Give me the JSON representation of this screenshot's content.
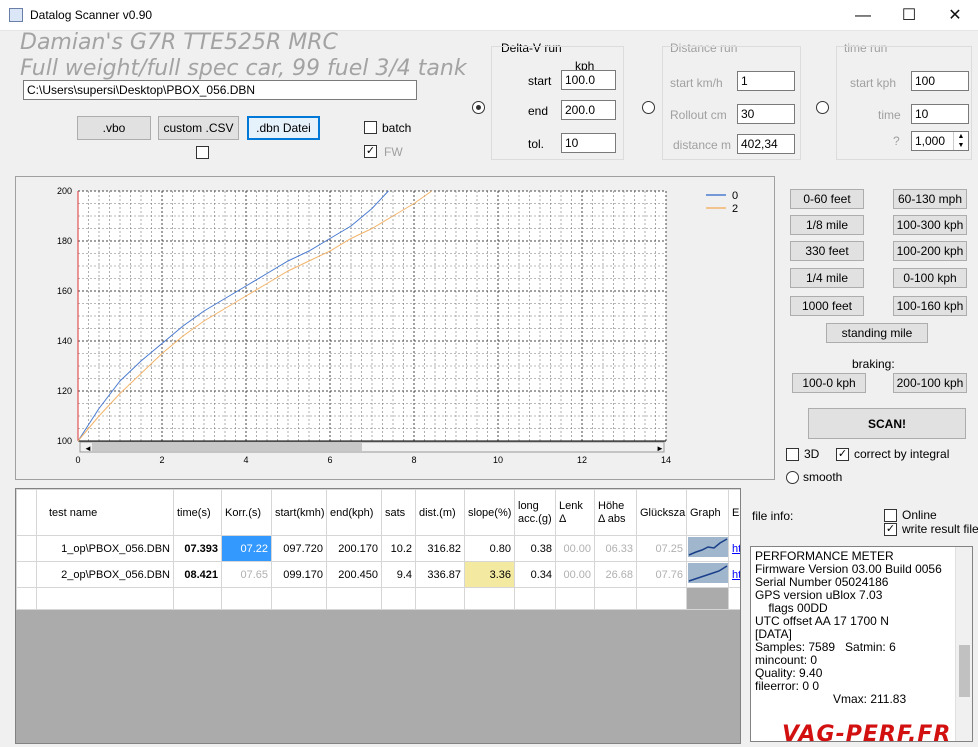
{
  "window": {
    "title": "Datalog Scanner v0.90",
    "minimize": "—",
    "maximize": "☐",
    "close": "✕"
  },
  "header": {
    "title_line1": "Damian's G7R TTE525R MRC",
    "title_line2": "Full weight/full spec car, 99 fuel 3/4 tank",
    "file_path": "C:\\Users\\supersi\\Desktop\\PBOX_056.DBN"
  },
  "file_buttons": {
    "vbo": ".vbo",
    "csv": "custom .CSV",
    "dbn": ".dbn Datei"
  },
  "options": {
    "batch_label": "batch",
    "batch_checked": false,
    "fw_label": "FW",
    "fw_checked": true,
    "csv_checked": false
  },
  "delta_v": {
    "title": "Delta-V run",
    "unit": "kph",
    "start_label": "start",
    "start": "100.0",
    "end_label": "end",
    "end": "200.0",
    "tol_label": "tol.",
    "tol": "10",
    "selected": true
  },
  "distance_run": {
    "title": "Distance run",
    "start_label": "start km/h",
    "start": "1",
    "rollout_label": "Rollout cm",
    "rollout": "30",
    "distance_label": "distance m",
    "distance": "402,34",
    "selected": false
  },
  "time_run": {
    "title": "time run",
    "start_label": "start kph",
    "start": "100",
    "time_label": "time",
    "time": "10",
    "q_label": "?",
    "q": "1,000",
    "selected": false
  },
  "presets": {
    "left": [
      "0-60 feet",
      "1/8 mile",
      "330 feet",
      "1/4 mile",
      "1000 feet"
    ],
    "right": [
      "60-130 mph",
      "100-300 kph",
      "100-200 kph",
      "0-100 kph",
      "100-160 kph"
    ],
    "standing_mile": "standing mile",
    "braking_label": "braking:",
    "braking": [
      "100-0 kph",
      "200-100 kph"
    ],
    "scan": "SCAN!"
  },
  "chart_opts": {
    "three_d": "3D",
    "three_d_checked": false,
    "integral": "correct by integral",
    "integral_checked": true,
    "smooth": "smooth",
    "smooth_selected": false
  },
  "chart_data": {
    "type": "line",
    "title": "",
    "xlabel": "",
    "ylabel": "",
    "xlim": [
      0,
      14
    ],
    "ylim": [
      100,
      200
    ],
    "xticks": [
      "0",
      "2",
      "4",
      "6",
      "8",
      "10",
      "12",
      "14"
    ],
    "yticks": [
      "100",
      "120",
      "140",
      "160",
      "180",
      "200"
    ],
    "grid": true,
    "legend_position": "top-right",
    "colors": [
      "#4a7bd0",
      "#f3b46b"
    ],
    "series": [
      {
        "name": "0",
        "x": [
          0,
          0.5,
          1,
          1.5,
          2,
          2.5,
          3,
          3.5,
          4,
          4.5,
          5,
          5.5,
          6,
          6.5,
          7,
          7.39
        ],
        "y": [
          100,
          113,
          124,
          132,
          139,
          146,
          152,
          157,
          162,
          167,
          172,
          176,
          181,
          186,
          193,
          200
        ]
      },
      {
        "name": "2",
        "x": [
          0,
          0.5,
          1,
          1.5,
          2,
          2.5,
          3,
          3.5,
          4,
          4.5,
          5,
          5.5,
          6,
          6.5,
          7,
          7.5,
          8,
          8.42
        ],
        "y": [
          100,
          110,
          119,
          127,
          135,
          142,
          148,
          153,
          158,
          163,
          168,
          172,
          176,
          181,
          185,
          190,
          195,
          200
        ]
      }
    ]
  },
  "table": {
    "columns": [
      "test name",
      "time(s)",
      "Korr.(s)",
      "start(kmh)",
      "end(kph)",
      "sats",
      "dist.(m)",
      "slope(%)",
      "long acc.(g)",
      "Lenk Δ",
      "Höhe Δ abs",
      "Glückszahl",
      "Graph",
      "Earth"
    ],
    "rows": [
      {
        "name": "1_op\\PBOX_056.DBN",
        "time": "07.393",
        "korr": "07.22",
        "start": "097.720",
        "end": "200.170",
        "sats": "10.2",
        "dist": "316.82",
        "slope": "0.80",
        "acc": "0.38",
        "lenk": "00.00",
        "hoehe": "06.33",
        "glueck": "07.25",
        "earth": "htt..."
      },
      {
        "name": "2_op\\PBOX_056.DBN",
        "time": "08.421",
        "korr": "07.65",
        "start": "099.170",
        "end": "200.450",
        "sats": "9.4",
        "dist": "336.87",
        "slope": "3.36",
        "acc": "0.34",
        "lenk": "00.00",
        "hoehe": "26.68",
        "glueck": "07.76",
        "earth": "htt..."
      }
    ]
  },
  "file_info": {
    "label": "file info:",
    "online": "Online",
    "online_checked": false,
    "write_result": "write result file",
    "write_checked": true,
    "lines": [
      "PERFORMANCE METER",
      "Firmware Version 03.00 Build 0056",
      "Serial Number 05024186",
      "GPS version uBlox 7.03",
      "    flags 00DD",
      "UTC offset AA 17 1700 N",
      "",
      "[DATA]",
      "Samples: 7589   Satmin: 6",
      "mincount: 0",
      "Quality: 9.40",
      "fileerror: 0 0"
    ],
    "vmax": "Vmax: 211.83"
  },
  "watermark": "VAG-PERF.FR"
}
